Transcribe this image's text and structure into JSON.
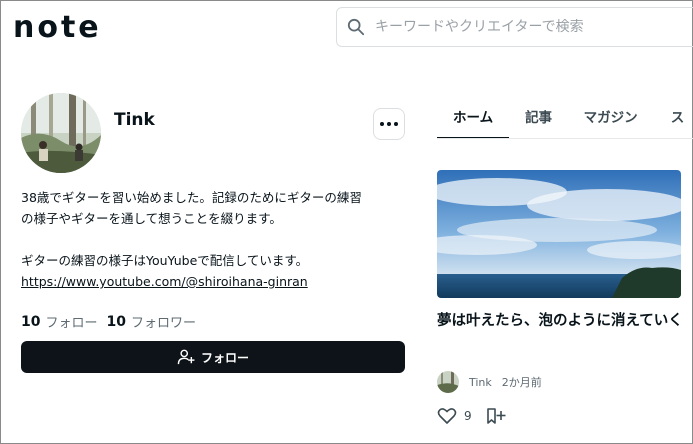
{
  "header": {
    "logo_text": "note",
    "search_placeholder": "キーワードやクリエイターで検索"
  },
  "profile": {
    "name": "Tink",
    "bio": {
      "line1": "38歳でギターを習い始めました。記録のためにギターの練習",
      "line2": "の様子やギターを通して想うことを綴ります。",
      "line3": "ギターの練習の様子はYouYubeで配信しています。",
      "link": "https://www.youtube.com/@shiroihana-ginran"
    },
    "follow_count": "10",
    "follow_label": "フォロー",
    "follower_count": "10",
    "follower_label": "フォロワー",
    "follow_button_label": "フォロー"
  },
  "tabs": [
    {
      "label": "ホーム",
      "active": true
    },
    {
      "label": "記事",
      "active": false
    },
    {
      "label": "マガジン",
      "active": false
    },
    {
      "label": "ス",
      "active": false
    }
  ],
  "article": {
    "title": "夢は叶えたら、泡のように消えていく",
    "author": "Tink",
    "time": "2か月前",
    "likes": "9"
  },
  "icons": {
    "search": "search-icon",
    "more": "more-horizontal-icon",
    "follow": "person-plus-icon",
    "like": "heart-icon",
    "save": "bookmark-plus-icon"
  }
}
